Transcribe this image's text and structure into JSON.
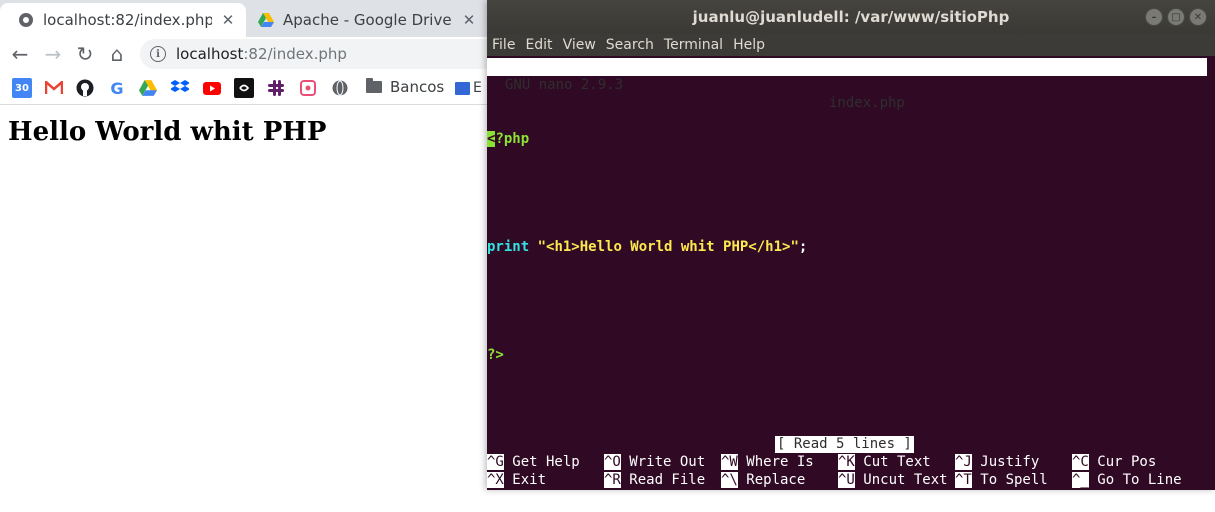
{
  "browser": {
    "tabs": [
      {
        "title": "localhost:82/index.php",
        "close": "✕",
        "active": true
      },
      {
        "title": "Apache - Google Drive",
        "close": "✕",
        "active": false
      }
    ],
    "nav": {
      "back": "←",
      "forward": "→",
      "reload": "↻",
      "home": "⌂"
    },
    "omnibox": {
      "info_glyph": "i",
      "host": "localhost",
      "path": ":82/index.php"
    },
    "bookmarks": {
      "icons": [
        "calendar-icon",
        "gmail-icon",
        "github-icon",
        "google-icon",
        "drive-icon",
        "dropbox-icon",
        "youtube-icon",
        "evernote-icon",
        "slack-icon",
        "app-icon",
        "globe-icon"
      ],
      "calendar_label": "30",
      "google_label": "G",
      "folder_label": "Bancos",
      "overflow_label": "E"
    },
    "page": {
      "heading": "Hello World whit PHP"
    }
  },
  "terminal": {
    "title": "juanlu@juanludell: /var/www/sitioPhp",
    "menu": [
      "File",
      "Edit",
      "View",
      "Search",
      "Terminal",
      "Help"
    ],
    "nano": {
      "version": "GNU nano 2.9.3",
      "filename": "index.php",
      "code": {
        "line1_cursor": "<",
        "line1_rest": "?php",
        "line3_fn": "print",
        "line3_space": " ",
        "line3_str": "\"<h1>Hello World whit PHP</h1>\"",
        "line3_end": ";",
        "line5": "?>"
      },
      "status": "[ Read 5 lines ]",
      "shortcuts": [
        {
          "key": "^G",
          "label": " Get Help"
        },
        {
          "key": "^O",
          "label": " Write Out"
        },
        {
          "key": "^W",
          "label": " Where Is"
        },
        {
          "key": "^K",
          "label": " Cut Text"
        },
        {
          "key": "^J",
          "label": " Justify"
        },
        {
          "key": "^C",
          "label": " Cur Pos"
        },
        {
          "key": "^X",
          "label": " Exit"
        },
        {
          "key": "^R",
          "label": " Read File"
        },
        {
          "key": "^\\",
          "label": " Replace"
        },
        {
          "key": "^U",
          "label": " Uncut Text"
        },
        {
          "key": "^T",
          "label": " To Spell"
        },
        {
          "key": "^_",
          "label": " Go To Line"
        }
      ]
    }
  },
  "colors": {
    "terminal_bg": "#300a24",
    "php_keyword": "#8ae234",
    "php_function": "#34e2e2",
    "php_string": "#fce94f"
  }
}
